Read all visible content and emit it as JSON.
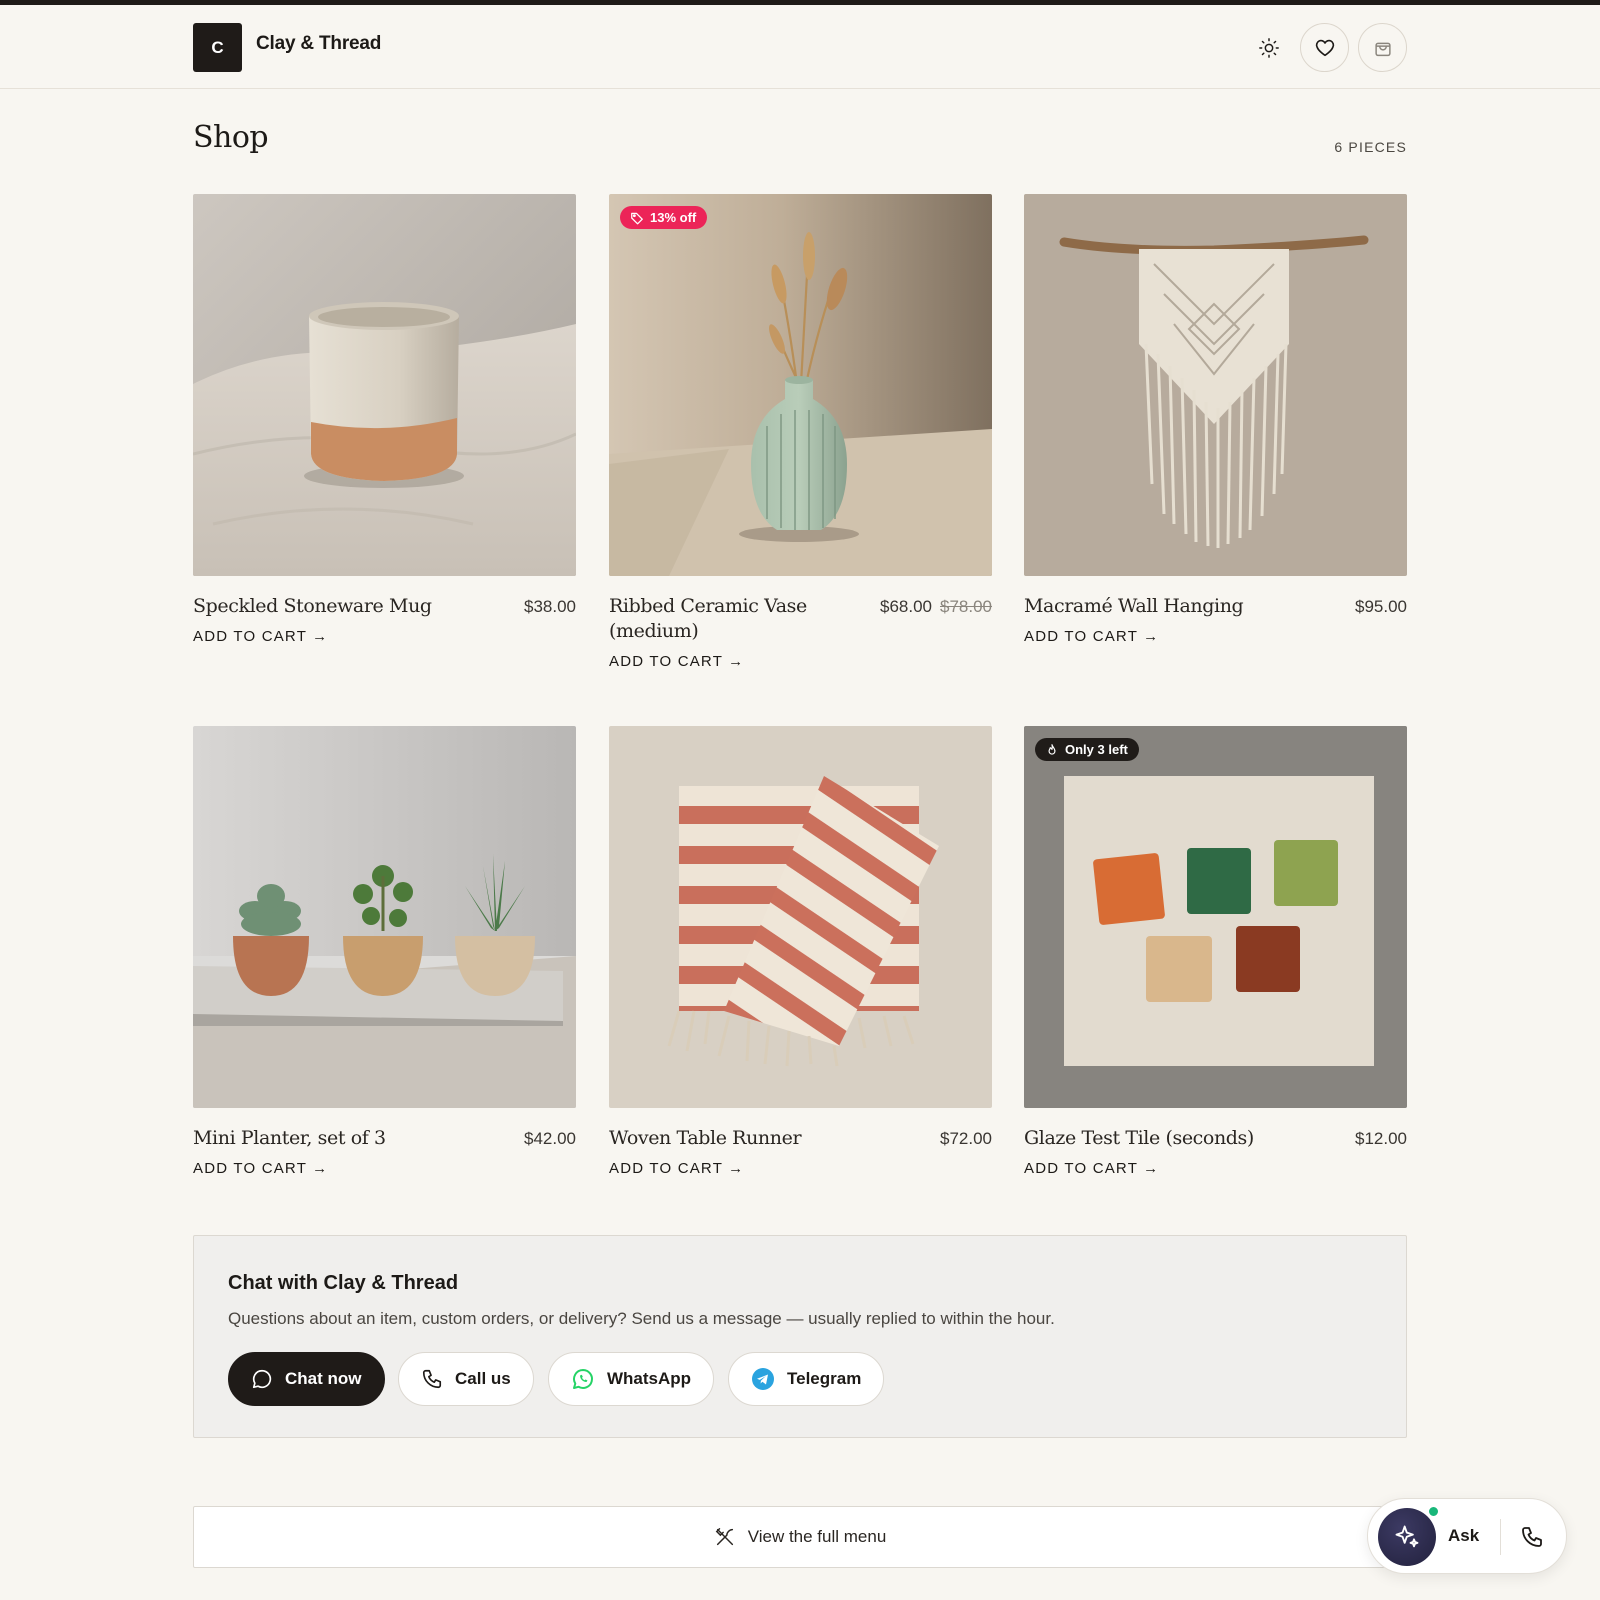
{
  "header": {
    "logo_letter": "C",
    "brand": "Clay & Thread"
  },
  "shop": {
    "title": "Shop",
    "count": "6 PIECES"
  },
  "products": [
    {
      "name": "Speckled Stoneware Mug",
      "price": "$38.00",
      "cta": "ADD TO CART →"
    },
    {
      "name": "Ribbed Ceramic Vase (medium)",
      "price": "$68.00",
      "old_price": "$78.00",
      "badge": "13% off",
      "cta": "ADD TO CART →"
    },
    {
      "name": "Macramé Wall Hanging",
      "price": "$95.00",
      "cta": "ADD TO CART →"
    },
    {
      "name": "Mini Planter, set of 3",
      "price": "$42.00",
      "cta": "ADD TO CART →"
    },
    {
      "name": "Woven Table Runner",
      "price": "$72.00",
      "cta": "ADD TO CART →"
    },
    {
      "name": "Glaze Test Tile (seconds)",
      "price": "$12.00",
      "badge": "Only 3 left",
      "cta": "ADD TO CART →"
    }
  ],
  "chat": {
    "title": "Chat with Clay & Thread",
    "subtitle": "Questions about an item, custom orders, or delivery? Send us a message — usually replied to within the hour.",
    "buttons": [
      "Chat now",
      "Call us",
      "WhatsApp",
      "Telegram"
    ]
  },
  "menu": {
    "label": "View the full menu"
  },
  "assistant": {
    "label": "Ask"
  },
  "colors": {
    "background": "#f8f6f1",
    "ink": "#1f1b18",
    "sale_badge": "#ec2458",
    "whatsapp": "#25d366",
    "telegram": "#2aa3df",
    "online_dot": "#19b77a"
  }
}
